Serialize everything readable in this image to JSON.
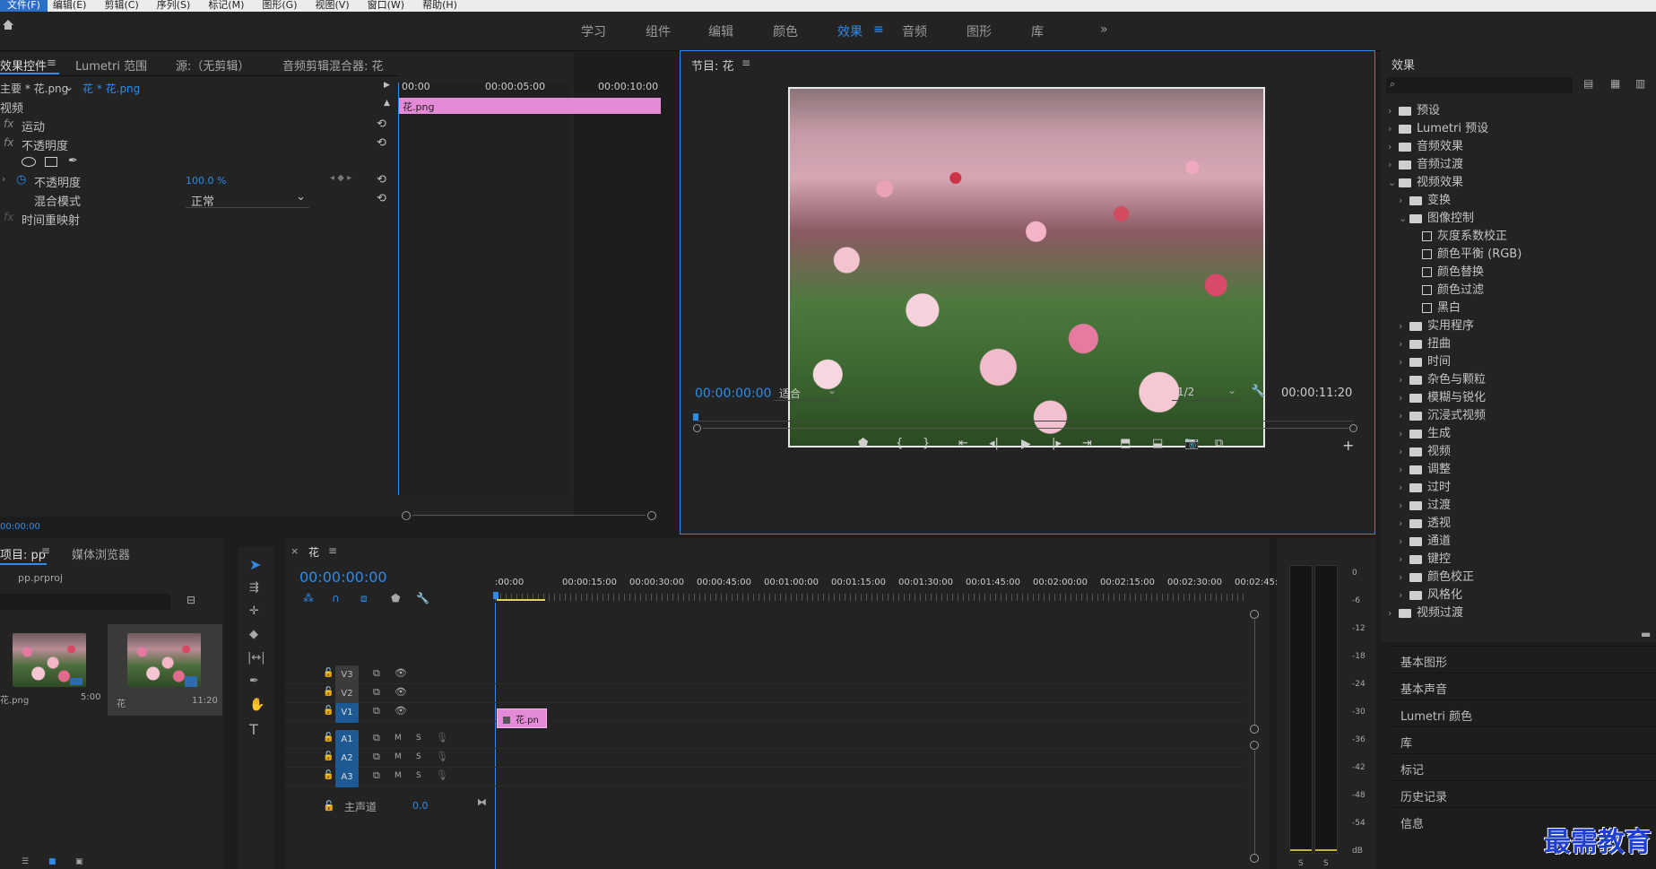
{
  "menubar": [
    "文件(F)",
    "编辑(E)",
    "剪辑(C)",
    "序列(S)",
    "标记(M)",
    "图形(G)",
    "视图(V)",
    "窗口(W)",
    "帮助(H)"
  ],
  "workspace_tabs": [
    "学习",
    "组件",
    "编辑",
    "颜色",
    "效果",
    "音频",
    "图形",
    "库"
  ],
  "workspace_active": "效果",
  "effect_controls": {
    "tabs": [
      "效果控件",
      "Lumetri 范围",
      "源:（无剪辑）",
      "音频剪辑混合器: 花"
    ],
    "source_label": "主要 * 花.png",
    "clip_label": "花 * 花.png",
    "section_video": "视频",
    "motion": "运动",
    "opacity": "不透明度",
    "opacity_prop": "不透明度",
    "opacity_value": "100.0 %",
    "blend_mode_label": "混合模式",
    "blend_mode_value": "正常",
    "time_remap": "时间重映射",
    "time0": "00:00",
    "time5": "00:00:05:00",
    "time10": "00:00:10:00",
    "clip_name": "花.png",
    "current_time": "00:00:00"
  },
  "program": {
    "title": "节目: 花",
    "timecode": "00:00:00:00",
    "fit": "适合",
    "resolution": "1/2",
    "duration": "00:00:11:20"
  },
  "effects_panel": {
    "title": "效果",
    "items": [
      {
        "label": "预设",
        "level": 0,
        "kind": "folder",
        "open": false
      },
      {
        "label": "Lumetri 预设",
        "level": 0,
        "kind": "folder",
        "open": false
      },
      {
        "label": "音频效果",
        "level": 0,
        "kind": "folder",
        "open": false
      },
      {
        "label": "音频过渡",
        "level": 0,
        "kind": "folder",
        "open": false
      },
      {
        "label": "视频效果",
        "level": 0,
        "kind": "folder",
        "open": true
      },
      {
        "label": "变换",
        "level": 1,
        "kind": "folder",
        "open": false
      },
      {
        "label": "图像控制",
        "level": 1,
        "kind": "folder",
        "open": true
      },
      {
        "label": "灰度系数校正",
        "level": 2,
        "kind": "preset"
      },
      {
        "label": "颜色平衡 (RGB)",
        "level": 2,
        "kind": "preset"
      },
      {
        "label": "颜色替换",
        "level": 2,
        "kind": "preset"
      },
      {
        "label": "颜色过滤",
        "level": 2,
        "kind": "preset"
      },
      {
        "label": "黑白",
        "level": 2,
        "kind": "preset"
      },
      {
        "label": "实用程序",
        "level": 1,
        "kind": "folder",
        "open": false
      },
      {
        "label": "扭曲",
        "level": 1,
        "kind": "folder",
        "open": false
      },
      {
        "label": "时间",
        "level": 1,
        "kind": "folder",
        "open": false
      },
      {
        "label": "杂色与颗粒",
        "level": 1,
        "kind": "folder",
        "open": false
      },
      {
        "label": "模糊与锐化",
        "level": 1,
        "kind": "folder",
        "open": false
      },
      {
        "label": "沉浸式视频",
        "level": 1,
        "kind": "folder",
        "open": false
      },
      {
        "label": "生成",
        "level": 1,
        "kind": "folder",
        "open": false
      },
      {
        "label": "视频",
        "level": 1,
        "kind": "folder",
        "open": false
      },
      {
        "label": "调整",
        "level": 1,
        "kind": "folder",
        "open": false
      },
      {
        "label": "过时",
        "level": 1,
        "kind": "folder",
        "open": false
      },
      {
        "label": "过渡",
        "level": 1,
        "kind": "folder",
        "open": false
      },
      {
        "label": "透视",
        "level": 1,
        "kind": "folder",
        "open": false
      },
      {
        "label": "通道",
        "level": 1,
        "kind": "folder",
        "open": false
      },
      {
        "label": "键控",
        "level": 1,
        "kind": "folder",
        "open": false
      },
      {
        "label": "颜色校正",
        "level": 1,
        "kind": "folder",
        "open": false
      },
      {
        "label": "风格化",
        "level": 1,
        "kind": "folder",
        "open": false
      },
      {
        "label": "视频过渡",
        "level": 0,
        "kind": "folder",
        "open": false
      }
    ]
  },
  "side_panels": [
    "基本图形",
    "基本声音",
    "Lumetri 颜色",
    "库",
    "标记",
    "历史记录",
    "信息"
  ],
  "project": {
    "tab1": "项目: pp",
    "tab2": "媒体浏览器",
    "file": "pp.prproj",
    "items": [
      {
        "name": "花.png",
        "duration": "5:00"
      },
      {
        "name": "花",
        "duration": "11:20"
      }
    ]
  },
  "timeline": {
    "seq_name": "花",
    "timecode": "00:00:00:00",
    "ruler": [
      ":00:00",
      "00:00:15:00",
      "00:00:30:00",
      "00:00:45:00",
      "00:01:00:00",
      "00:01:15:00",
      "00:01:30:00",
      "00:01:45:00",
      "00:02:00:00",
      "00:02:15:00",
      "00:02:30:00",
      "00:02:45:"
    ],
    "video_tracks": [
      "V3",
      "V2",
      "V1"
    ],
    "audio_tracks": [
      "A1",
      "A2",
      "A3"
    ],
    "master": "主声道",
    "master_value": "0.0",
    "clip_label": "花.pn"
  },
  "audio_meter": {
    "scale": [
      "0",
      "-6",
      "-12",
      "-18",
      "-24",
      "-30",
      "-36",
      "-42",
      "-48",
      "-54",
      "dB"
    ],
    "solo": [
      "S",
      "S"
    ]
  },
  "watermark": "最需教育",
  "colors": {
    "accent": "#2d8ceb",
    "clip": "#e58ad7",
    "panel": "#232323"
  }
}
